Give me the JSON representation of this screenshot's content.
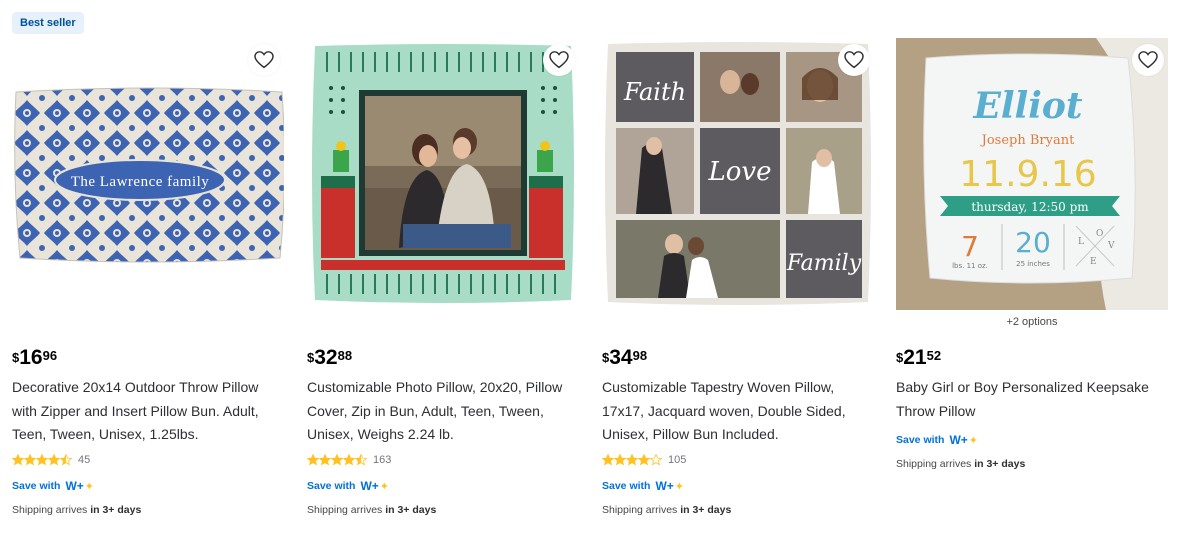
{
  "products": [
    {
      "badge": "Best seller",
      "price": {
        "currency": "$",
        "dollars": "16",
        "cents": "96"
      },
      "title": "Decorative 20x14 Outdoor Throw Pillow with Zipper and Insert Pillow Bun. Adult, Teen, Tween, Unisex, 1.25lbs.",
      "rating": 4.5,
      "reviews": "45",
      "save_label": "Save with",
      "wplus": "W+",
      "shipping_prefix": "Shipping arrives ",
      "shipping_time": "in 3+ days",
      "image_text": "The Lawrence family"
    },
    {
      "price": {
        "currency": "$",
        "dollars": "32",
        "cents": "88"
      },
      "title": "Customizable Photo Pillow, 20x20, Pillow Cover, Zip in Bun, Adult, Teen, Tween, Unisex, Weighs 2.24 lb.",
      "rating": 4.5,
      "reviews": "163",
      "save_label": "Save with",
      "wplus": "W+",
      "shipping_prefix": "Shipping arrives ",
      "shipping_time": "in 3+ days"
    },
    {
      "price": {
        "currency": "$",
        "dollars": "34",
        "cents": "98"
      },
      "title": "Customizable Tapestry Woven Pillow, 17x17, Jacquard woven, Double Sided, Unisex, Pillow Bun Included.",
      "rating": 4,
      "reviews": "105",
      "save_label": "Save with",
      "wplus": "W+",
      "shipping_prefix": "Shipping arrives ",
      "shipping_time": "in 3+ days",
      "image_words": {
        "faith": "Faith",
        "love": "Love",
        "family": "Family"
      }
    },
    {
      "options": "+2 options",
      "price": {
        "currency": "$",
        "dollars": "21",
        "cents": "52"
      },
      "title": "Baby Girl or Boy Personalized Keepsake Throw Pillow",
      "save_label": "Save with",
      "wplus": "W+",
      "shipping_prefix": "Shipping arrives ",
      "shipping_time": "in 3+ days",
      "image_text": {
        "name": "Elliot",
        "middle": "Joseph Bryant",
        "date": "11.9.16",
        "time": "thursday, 12:50 pm",
        "weight": "7",
        "weight_unit": "lbs. 11 oz.",
        "length": "20",
        "length_unit": "25 inches",
        "love_l": "L",
        "love_o": "O",
        "love_v": "V",
        "love_e": "E"
      }
    }
  ],
  "icons": {
    "favorite": "heart-outline-icon",
    "star": "star-icon",
    "walmart_plus": "walmart-plus-logo"
  },
  "colors": {
    "accent": "#0071dc",
    "star": "#ffc220",
    "badge_bg": "#e6f1fc",
    "badge_text": "#004f9a"
  }
}
